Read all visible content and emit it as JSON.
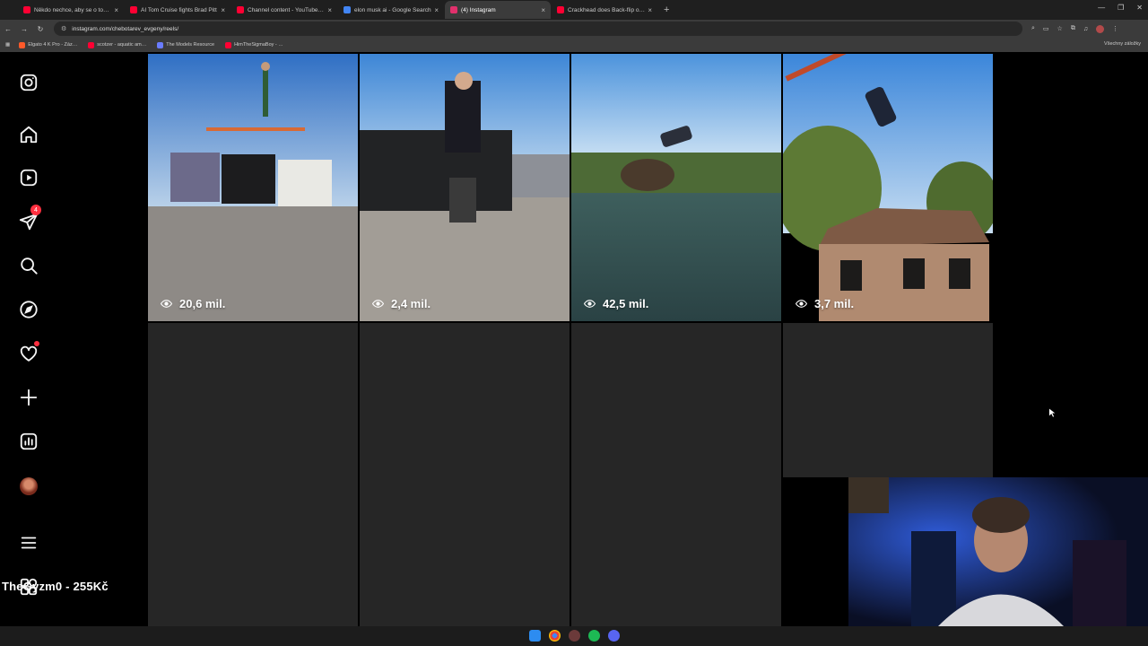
{
  "browser": {
    "tabs": [
      {
        "title": "Někdo nechce, aby se o tom m…",
        "favicon_color": "#ff0033",
        "active": false
      },
      {
        "title": "AI Tom Cruise fights Brad Pitt",
        "favicon_color": "#ff0033",
        "active": false
      },
      {
        "title": "Channel content - YouTube Stu…",
        "favicon_color": "#ff0033",
        "active": false
      },
      {
        "title": "elon musk ai - Google Search",
        "favicon_color": "#4285f4",
        "active": false
      },
      {
        "title": "(4) Instagram",
        "favicon_color": "#e1306c",
        "active": true
      },
      {
        "title": "Crackhead does Back-flip off cl…",
        "favicon_color": "#ff0033",
        "active": false
      }
    ],
    "new_tab": "+",
    "url": "instagram.com/chebotarev_evgeny/reels/",
    "bookmarks": [
      {
        "label": "Elgato 4 K Pro - Záz…",
        "color": "#ff5a2a"
      },
      {
        "label": "scotzer - aquatic am…",
        "color": "#ff0033"
      },
      {
        "label": "The Models Resource",
        "color": "#6a7cff"
      },
      {
        "label": "HimTheSigmaBoy - …",
        "color": "#ff0033"
      }
    ],
    "bookmarks_right": "Všechny záložky"
  },
  "sidebar": {
    "messages_badge": "4"
  },
  "reels": [
    {
      "views": "20,6 mil."
    },
    {
      "views": "2,4 mil."
    },
    {
      "views": "42,5 mil."
    },
    {
      "views": "3,7 mil."
    }
  ],
  "overlay": {
    "streamer_label": "TheGyzm0 - 255Kč"
  },
  "colors": {
    "background": "#000000",
    "placeholder": "#262626",
    "notification": "#ff3040"
  }
}
